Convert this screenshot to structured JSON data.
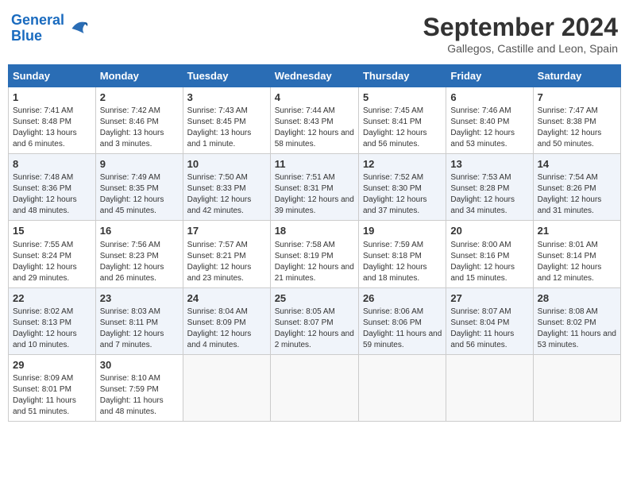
{
  "header": {
    "logo_line1": "General",
    "logo_line2": "Blue",
    "month_title": "September 2024",
    "subtitle": "Gallegos, Castille and Leon, Spain"
  },
  "days_of_week": [
    "Sunday",
    "Monday",
    "Tuesday",
    "Wednesday",
    "Thursday",
    "Friday",
    "Saturday"
  ],
  "weeks": [
    [
      {
        "day": "1",
        "rise": "Sunrise: 7:41 AM",
        "set": "Sunset: 8:48 PM",
        "light": "Daylight: 13 hours and 6 minutes."
      },
      {
        "day": "2",
        "rise": "Sunrise: 7:42 AM",
        "set": "Sunset: 8:46 PM",
        "light": "Daylight: 13 hours and 3 minutes."
      },
      {
        "day": "3",
        "rise": "Sunrise: 7:43 AM",
        "set": "Sunset: 8:45 PM",
        "light": "Daylight: 13 hours and 1 minute."
      },
      {
        "day": "4",
        "rise": "Sunrise: 7:44 AM",
        "set": "Sunset: 8:43 PM",
        "light": "Daylight: 12 hours and 58 minutes."
      },
      {
        "day": "5",
        "rise": "Sunrise: 7:45 AM",
        "set": "Sunset: 8:41 PM",
        "light": "Daylight: 12 hours and 56 minutes."
      },
      {
        "day": "6",
        "rise": "Sunrise: 7:46 AM",
        "set": "Sunset: 8:40 PM",
        "light": "Daylight: 12 hours and 53 minutes."
      },
      {
        "day": "7",
        "rise": "Sunrise: 7:47 AM",
        "set": "Sunset: 8:38 PM",
        "light": "Daylight: 12 hours and 50 minutes."
      }
    ],
    [
      {
        "day": "8",
        "rise": "Sunrise: 7:48 AM",
        "set": "Sunset: 8:36 PM",
        "light": "Daylight: 12 hours and 48 minutes."
      },
      {
        "day": "9",
        "rise": "Sunrise: 7:49 AM",
        "set": "Sunset: 8:35 PM",
        "light": "Daylight: 12 hours and 45 minutes."
      },
      {
        "day": "10",
        "rise": "Sunrise: 7:50 AM",
        "set": "Sunset: 8:33 PM",
        "light": "Daylight: 12 hours and 42 minutes."
      },
      {
        "day": "11",
        "rise": "Sunrise: 7:51 AM",
        "set": "Sunset: 8:31 PM",
        "light": "Daylight: 12 hours and 39 minutes."
      },
      {
        "day": "12",
        "rise": "Sunrise: 7:52 AM",
        "set": "Sunset: 8:30 PM",
        "light": "Daylight: 12 hours and 37 minutes."
      },
      {
        "day": "13",
        "rise": "Sunrise: 7:53 AM",
        "set": "Sunset: 8:28 PM",
        "light": "Daylight: 12 hours and 34 minutes."
      },
      {
        "day": "14",
        "rise": "Sunrise: 7:54 AM",
        "set": "Sunset: 8:26 PM",
        "light": "Daylight: 12 hours and 31 minutes."
      }
    ],
    [
      {
        "day": "15",
        "rise": "Sunrise: 7:55 AM",
        "set": "Sunset: 8:24 PM",
        "light": "Daylight: 12 hours and 29 minutes."
      },
      {
        "day": "16",
        "rise": "Sunrise: 7:56 AM",
        "set": "Sunset: 8:23 PM",
        "light": "Daylight: 12 hours and 26 minutes."
      },
      {
        "day": "17",
        "rise": "Sunrise: 7:57 AM",
        "set": "Sunset: 8:21 PM",
        "light": "Daylight: 12 hours and 23 minutes."
      },
      {
        "day": "18",
        "rise": "Sunrise: 7:58 AM",
        "set": "Sunset: 8:19 PM",
        "light": "Daylight: 12 hours and 21 minutes."
      },
      {
        "day": "19",
        "rise": "Sunrise: 7:59 AM",
        "set": "Sunset: 8:18 PM",
        "light": "Daylight: 12 hours and 18 minutes."
      },
      {
        "day": "20",
        "rise": "Sunrise: 8:00 AM",
        "set": "Sunset: 8:16 PM",
        "light": "Daylight: 12 hours and 15 minutes."
      },
      {
        "day": "21",
        "rise": "Sunrise: 8:01 AM",
        "set": "Sunset: 8:14 PM",
        "light": "Daylight: 12 hours and 12 minutes."
      }
    ],
    [
      {
        "day": "22",
        "rise": "Sunrise: 8:02 AM",
        "set": "Sunset: 8:13 PM",
        "light": "Daylight: 12 hours and 10 minutes."
      },
      {
        "day": "23",
        "rise": "Sunrise: 8:03 AM",
        "set": "Sunset: 8:11 PM",
        "light": "Daylight: 12 hours and 7 minutes."
      },
      {
        "day": "24",
        "rise": "Sunrise: 8:04 AM",
        "set": "Sunset: 8:09 PM",
        "light": "Daylight: 12 hours and 4 minutes."
      },
      {
        "day": "25",
        "rise": "Sunrise: 8:05 AM",
        "set": "Sunset: 8:07 PM",
        "light": "Daylight: 12 hours and 2 minutes."
      },
      {
        "day": "26",
        "rise": "Sunrise: 8:06 AM",
        "set": "Sunset: 8:06 PM",
        "light": "Daylight: 11 hours and 59 minutes."
      },
      {
        "day": "27",
        "rise": "Sunrise: 8:07 AM",
        "set": "Sunset: 8:04 PM",
        "light": "Daylight: 11 hours and 56 minutes."
      },
      {
        "day": "28",
        "rise": "Sunrise: 8:08 AM",
        "set": "Sunset: 8:02 PM",
        "light": "Daylight: 11 hours and 53 minutes."
      }
    ],
    [
      {
        "day": "29",
        "rise": "Sunrise: 8:09 AM",
        "set": "Sunset: 8:01 PM",
        "light": "Daylight: 11 hours and 51 minutes."
      },
      {
        "day": "30",
        "rise": "Sunrise: 8:10 AM",
        "set": "Sunset: 7:59 PM",
        "light": "Daylight: 11 hours and 48 minutes."
      },
      null,
      null,
      null,
      null,
      null
    ]
  ]
}
